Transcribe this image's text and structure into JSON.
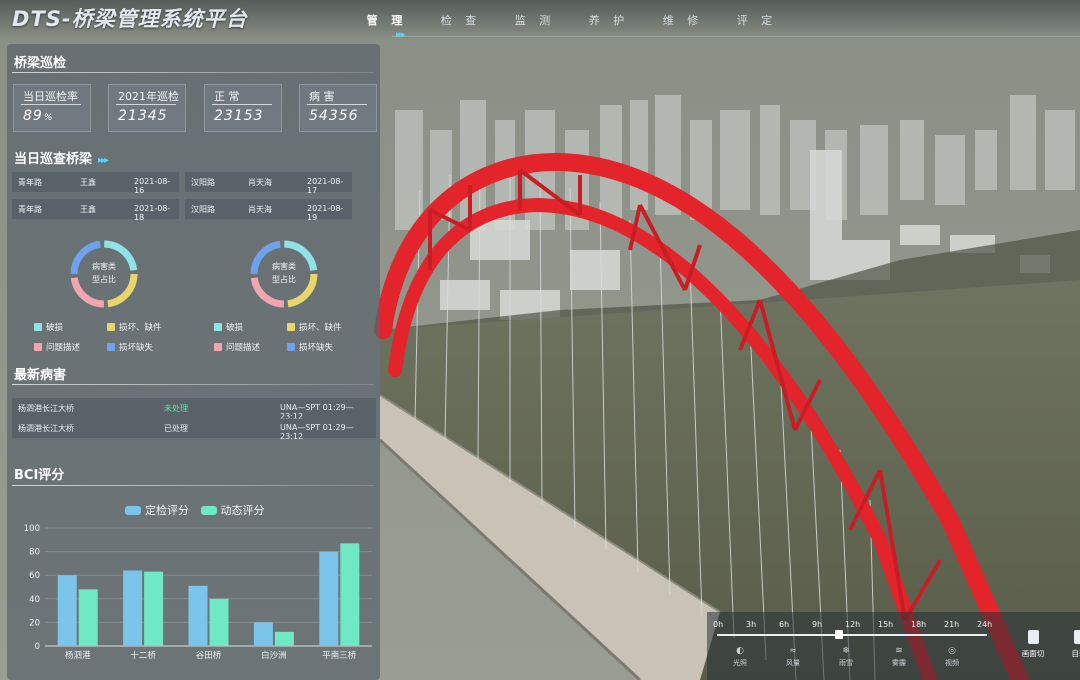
{
  "app": {
    "title": "DTS-桥梁管理系统平台"
  },
  "nav": {
    "items": [
      "管 理",
      "检 查",
      "监 测",
      "养 护",
      "维 修",
      "评 定"
    ],
    "active_index": 0
  },
  "inspection": {
    "title": "桥梁巡检",
    "stats": [
      {
        "label": "当日巡检率",
        "value": "89",
        "unit": "%"
      },
      {
        "label": "2021年巡检",
        "value": "21345",
        "unit": ""
      },
      {
        "label": "正 常",
        "value": "23153",
        "unit": ""
      },
      {
        "label": "病 害",
        "value": "54356",
        "unit": ""
      }
    ]
  },
  "today_bridges": {
    "title": "当日巡查桥梁",
    "rows": [
      {
        "left": {
          "road": "青年路",
          "person": "王鑫",
          "date": "2021-08-16"
        },
        "right": {
          "road": "汉阳路",
          "person": "肖天海",
          "date": "2021-08-17"
        }
      },
      {
        "left": {
          "road": "青年路",
          "person": "王鑫",
          "date": "2021-08-18"
        },
        "right": {
          "road": "汉阳路",
          "person": "肖天海",
          "date": "2021-08-19"
        }
      }
    ],
    "donuts": [
      {
        "center_line1": "病害类",
        "center_line2": "型占比",
        "segments": [
          25,
          25,
          25,
          25
        ]
      },
      {
        "center_line1": "病害类",
        "center_line2": "型占比",
        "segments": [
          25,
          25,
          25,
          25
        ]
      }
    ],
    "legend": [
      {
        "label": "破损",
        "color": "#8fe3e6"
      },
      {
        "label": "损坏、缺件",
        "color": "#e9d66b"
      },
      {
        "label": "问题描述",
        "color": "#f0a6ad"
      },
      {
        "label": "损坏缺失",
        "color": "#6fa2ea"
      }
    ]
  },
  "latest_damage": {
    "title": "最新病害",
    "rows": [
      {
        "bridge": "杨泗港长江大桥",
        "status": "未处理",
        "status_color": "#5fe0a8",
        "time": "UNA—SPT 01:29—23:12"
      },
      {
        "bridge": "杨泗港长江大桥",
        "status": "已处理",
        "status_color": "#e8eef2",
        "time": "UNA—SPT 01:29—23:12"
      }
    ]
  },
  "bci": {
    "title": "BCI评分"
  },
  "chart_data": {
    "type": "bar",
    "categories": [
      "杨泗港",
      "十二桥",
      "谷田桥",
      "白沙洲",
      "平南三桥"
    ],
    "series": [
      {
        "name": "定检评分",
        "values": [
          60,
          64,
          51,
          20,
          80
        ],
        "color": "#7bc4ea"
      },
      {
        "name": "动态评分",
        "values": [
          48,
          63,
          40,
          12,
          87
        ],
        "color": "#6fe8c4"
      }
    ],
    "ylim": [
      0,
      100
    ],
    "yticks": [
      0,
      20,
      40,
      60,
      80,
      100
    ],
    "xlabel": "",
    "ylabel": ""
  },
  "timeline": {
    "ticks": [
      "0h",
      "3h",
      "6h",
      "9h",
      "12h",
      "15h",
      "18h",
      "21h",
      "24h"
    ],
    "current": 0.45,
    "buttons": [
      "光照",
      "风量",
      "雨雪",
      "雾霾",
      "视频"
    ],
    "side_buttons": [
      "画面切",
      "自转"
    ]
  },
  "colors": {
    "bridge_red": "#e3242b",
    "accent": "#4fd7ff"
  }
}
